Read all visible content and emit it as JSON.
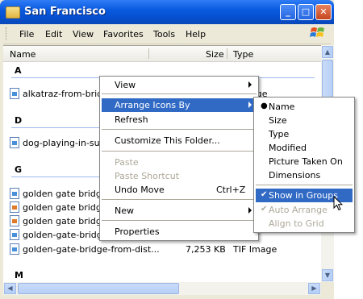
{
  "window": {
    "title": "San Francisco",
    "buttons": {
      "minimize": "_",
      "maximize": "□",
      "close": "✕"
    }
  },
  "menubar": {
    "items": [
      "File",
      "Edit",
      "View",
      "Favorites",
      "Tools",
      "Help"
    ]
  },
  "columns": {
    "name": "Name",
    "size": "Size",
    "type": "Type"
  },
  "groups": {
    "a": {
      "letter": "A",
      "files": [
        {
          "name": "alkatraz-from-bridge",
          "type": "age"
        }
      ]
    },
    "d": {
      "letter": "D",
      "files": [
        {
          "name": "dog-playing-in-surf"
        }
      ]
    },
    "g": {
      "letter": "G",
      "files": [
        {
          "name": "golden gate bridge1"
        },
        {
          "name": "golden gate bridge 2"
        },
        {
          "name": "golden gate bridge 3"
        },
        {
          "name": "golden-gate-bridge5"
        },
        {
          "name": "golden-gate-bridge-from-dist...",
          "size": "7,253 KB",
          "type": "TIF Image"
        }
      ]
    },
    "m": {
      "letter": "M"
    }
  },
  "context_menu": {
    "items": [
      {
        "label": "View",
        "submenu": true
      },
      {
        "label": "Arrange Icons By",
        "submenu": true,
        "highlighted": true
      },
      {
        "label": "Refresh"
      },
      {
        "label": "Customize This Folder..."
      },
      {
        "label": "Paste",
        "disabled": true
      },
      {
        "label": "Paste Shortcut",
        "disabled": true
      },
      {
        "label": "Undo Move",
        "shortcut": "Ctrl+Z"
      },
      {
        "label": "New",
        "submenu": true
      },
      {
        "label": "Properties"
      }
    ]
  },
  "arrange_menu": {
    "items": [
      {
        "label": "Name",
        "bullet": true
      },
      {
        "label": "Size"
      },
      {
        "label": "Type"
      },
      {
        "label": "Modified"
      },
      {
        "label": "Picture Taken On"
      },
      {
        "label": "Dimensions"
      },
      {
        "label": "Show in Groups",
        "checked": true,
        "highlighted": true
      },
      {
        "label": "Auto Arrange",
        "checked": true,
        "disabled": true
      },
      {
        "label": "Align to Grid",
        "disabled": true
      }
    ]
  },
  "glyphs": {
    "bullet": "●",
    "check": "✔"
  },
  "colors": {
    "highlight": "#316ac5",
    "titlebar": "#0a5be0",
    "disabled": "#aca899"
  }
}
